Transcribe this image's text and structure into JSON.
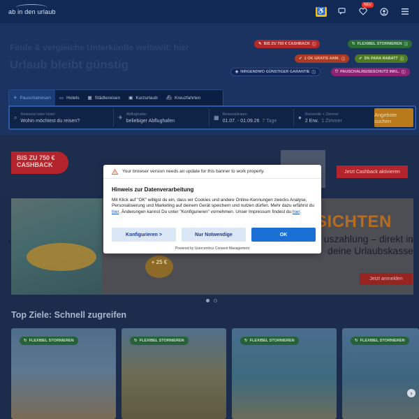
{
  "header": {
    "logo_text": "ab in den urlaub",
    "notification_badge": "NEU"
  },
  "hero": {
    "title": "Finde & vergleiche Unterkünfte weltweit: hier",
    "subtitle": "Urlaub bleibt günstig",
    "badges": [
      {
        "label": "BIS ZU 750 € CASHBACK",
        "icon": "tag-icon",
        "color": "#e0322a"
      },
      {
        "label": "FLEXIBEL STORNIEREN",
        "icon": "refresh-icon",
        "color": "#2f8a3d"
      },
      {
        "label": "1 OK GRATIS ANM.",
        "icon": "check-icon",
        "color": "#e0322a"
      },
      {
        "label": "5% PARA RABATT",
        "icon": "check-icon",
        "color": "#2f8a3d"
      },
      {
        "label": "NIRGENDWO GÜNSTIGER GARANTIE",
        "icon": "tag-icon",
        "color": "#1b3a7a"
      },
      {
        "label": "PAUSCHALREISESCHUTZ INKL.",
        "icon": "shield-icon",
        "color": "#b62c8a"
      }
    ]
  },
  "search": {
    "tabs": [
      {
        "label": "Pauschalreisen",
        "icon": "plane-icon"
      },
      {
        "label": "Hotels",
        "icon": "bed-icon"
      },
      {
        "label": "Städtereisen",
        "icon": "building-icon"
      },
      {
        "label": "Kurzurlaub",
        "icon": "suitcase-icon"
      },
      {
        "label": "Kreuzfahrten",
        "icon": "ship-icon"
      }
    ],
    "destination_label": "Reiseziel oder Hotel",
    "destination_value": "Wohin möchtest du reisen?",
    "airport_label": "Abflughafen",
    "airport_value": "beliebiger Abflughafen",
    "period_label": "Reisezeitraum",
    "period_value": "01.07. - 01.09.26",
    "period_extra": "7 Tage",
    "guests_label": "Reisende + Zimmer",
    "guests_value": "2 Erw.",
    "guests_extra": "1 Zimmer",
    "submit_label": "Angebote suchen"
  },
  "cashback": {
    "tag": "BIS ZU 750 € CASHBACK",
    "button": "Jetzt Cashback aktivieren"
  },
  "banner": {
    "title": "SICHTEN",
    "subtitle": "uszahlung – direkt in deine Urlaubskasse",
    "bonus": "+ 25 €",
    "button": "Jetzt anmelden"
  },
  "top_destinations": {
    "heading": "Top Ziele: Schnell zugreifen",
    "cards": [
      {
        "tag": "FLEXIBEL STORNIEREN"
      },
      {
        "tag": "FLEXIBEL STORNIEREN"
      },
      {
        "tag": "FLEXIBEL STORNIEREN"
      },
      {
        "tag": "FLEXIBEL STORNIEREN"
      }
    ]
  },
  "consent": {
    "warning": "Your browser version needs an update for this banner to work properly.",
    "title": "Hinweis zur Datenverarbeitung",
    "text_1": "Mit Klick auf \"OK\" willigst du ein, dass wir Cookies und andere Online-Kennungen zwecks Analyse, Personalisierung und Marketing auf deinem Gerät speichern und nutzen dürfen. Mehr dazu erfährst du ",
    "link_1": "hier",
    "text_2": ". Änderungen kannst Du unter \"Konfigurieren\" vornehmen. Unser Impressum findest du ",
    "link_2": "hier",
    "text_3": ".",
    "btn_configure": "Konfigurieren >",
    "btn_necessary": "Nur Notwendige",
    "btn_ok": "OK",
    "powered": "Powered by Usercentrics Consent Management"
  }
}
